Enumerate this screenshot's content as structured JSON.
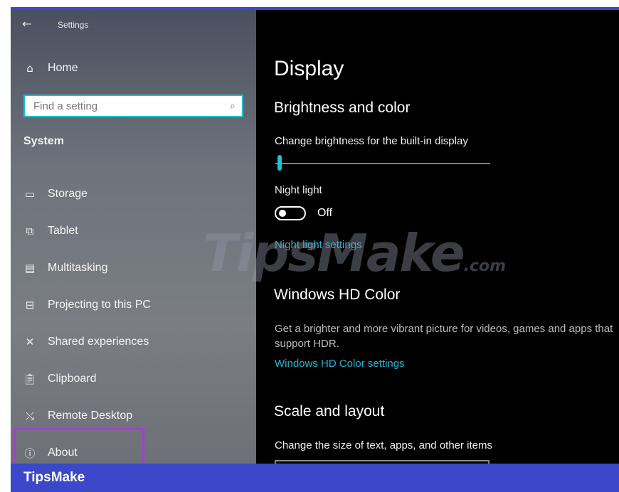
{
  "window": {
    "title": "Settings",
    "back_icon": "back-arrow-icon"
  },
  "sidebar": {
    "home": {
      "label": "Home",
      "icon": "home-icon"
    },
    "search": {
      "placeholder": "Find a setting",
      "icon": "search-icon"
    },
    "section": "System",
    "items": [
      {
        "label": "Storage",
        "icon": "storage-icon"
      },
      {
        "label": "Tablet",
        "icon": "tablet-icon"
      },
      {
        "label": "Multitasking",
        "icon": "multitasking-icon"
      },
      {
        "label": "Projecting to this PC",
        "icon": "projecting-icon"
      },
      {
        "label": "Shared experiences",
        "icon": "shared-experiences-icon"
      },
      {
        "label": "Clipboard",
        "icon": "clipboard-icon"
      },
      {
        "label": "Remote Desktop",
        "icon": "remote-desktop-icon"
      },
      {
        "label": "About",
        "icon": "info-icon"
      }
    ],
    "highlight_color": "#a23fd0"
  },
  "content": {
    "title": "Display",
    "brightness": {
      "heading": "Brightness and color",
      "slider_label": "Change brightness for the built-in display",
      "slider_value": 0.01
    },
    "night_light": {
      "label": "Night light",
      "toggle_state": "Off",
      "link": "Night light settings"
    },
    "hdr": {
      "heading": "Windows HD Color",
      "description": "Get a brighter and more vibrant picture for videos, games and apps that support HDR.",
      "link": "Windows HD Color settings"
    },
    "scale": {
      "heading": "Scale and layout",
      "label": "Change the size of text, apps, and other items"
    }
  },
  "watermark": {
    "text": "TipsMake",
    "suffix": ".com"
  },
  "footer": {
    "text": "TipsMake"
  },
  "colors": {
    "accent": "#19c2d6",
    "link": "#27b3d8",
    "banner": "#3a48c9"
  }
}
